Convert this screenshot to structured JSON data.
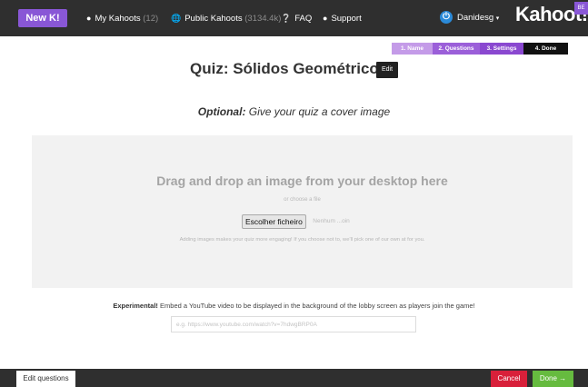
{
  "nav": {
    "new_k": "New K!",
    "my_kahoots": "My Kahoots",
    "my_kahoots_count": "(12)",
    "public_kahoots": "Public Kahoots",
    "public_kahoots_count": "(3134.4k)",
    "faq": "FAQ",
    "support": "Support",
    "username": "Danidesg",
    "logo": "Kahoot!",
    "beta": "BE"
  },
  "steps": [
    {
      "label": "1. Name"
    },
    {
      "label": "2. Questions"
    },
    {
      "label": "3. Settings"
    },
    {
      "label": "4. Done"
    }
  ],
  "quiz": {
    "title": "Quiz: Sólidos Geométricos",
    "edit_label": "Edit"
  },
  "cover": {
    "optional_label": "Optional:",
    "text": "Give your quiz a cover image"
  },
  "dropzone": {
    "title": "Drag and drop an image from your desktop here",
    "or_choose": "or choose a file",
    "file_button": "Escolher ficheiro",
    "no_file": "Nenhum ...oin",
    "hint": "Adding images makes your quiz more engaging! If you choose not to, we'll pick one of our own at for you."
  },
  "youtube": {
    "label": "Experimental!",
    "text": "Embed a YouTube video to be displayed in the background of the lobby screen as players join the game!",
    "placeholder": "e.g. https://www.youtube.com/watch?v=7hdwgBRP0A"
  },
  "footer": {
    "edit_questions": "Edit questions",
    "cancel": "Cancel",
    "done": "Done →"
  },
  "colors": {
    "brand_purple": "#8957d6",
    "topbar": "#2f2f2f",
    "cancel": "#d8203a",
    "done": "#66bb3f"
  }
}
